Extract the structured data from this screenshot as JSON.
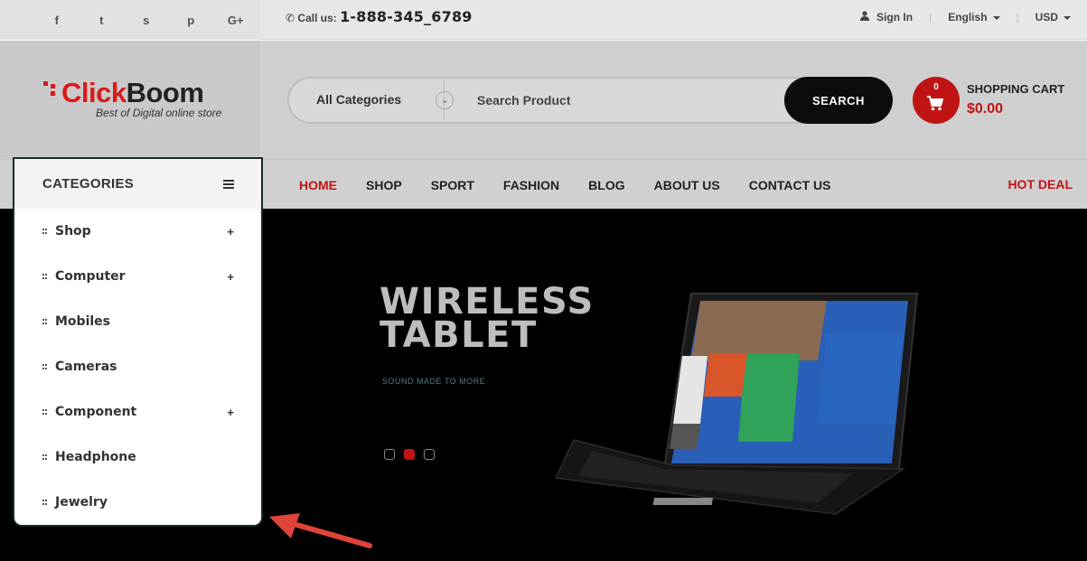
{
  "topbar": {
    "social_icons": [
      "facebook-icon",
      "twitter-icon",
      "skype-icon",
      "pinterest-icon",
      "google-plus-icon"
    ],
    "social_glyphs": [
      "f",
      "t",
      "s",
      "p",
      "G+"
    ],
    "call_label": "Call us:",
    "phone": "1-888-345_6789",
    "sign_in": "Sign In",
    "language": "English",
    "currency": "USD"
  },
  "header": {
    "logo_click": "Click",
    "logo_boom": "Boom",
    "logo_tagline": "Best of Digital online store",
    "search": {
      "category": "All Categories",
      "placeholder": "Search Product",
      "button": "SEARCH"
    },
    "cart": {
      "count": "0",
      "title": "SHOPPING CART",
      "total": "$0.00"
    }
  },
  "nav": {
    "items": [
      "HOME",
      "SHOP",
      "SPORT",
      "FASHION",
      "BLOG",
      "ABOUT US",
      "CONTACT US"
    ],
    "active": "HOME",
    "hot_deal": "HOT DEAL"
  },
  "categories": {
    "title": "CATEGORIES",
    "items": [
      {
        "label": "Shop",
        "expandable": "+"
      },
      {
        "label": "Computer",
        "expandable": "+"
      },
      {
        "label": "Mobiles",
        "expandable": ""
      },
      {
        "label": "Cameras",
        "expandable": ""
      },
      {
        "label": "Component",
        "expandable": "+"
      },
      {
        "label": "Headphone",
        "expandable": ""
      },
      {
        "label": "Jewelry",
        "expandable": ""
      }
    ]
  },
  "banner": {
    "title_line1": "WIRELESS",
    "title_line2": "TABLET",
    "subtitle": "SOUND MADE TO MORE",
    "slides": 3,
    "active_slide": 2
  },
  "colors": {
    "accent": "#c01414",
    "dark": "#0c0c0c",
    "annotation_arrow": "#e0433a"
  }
}
